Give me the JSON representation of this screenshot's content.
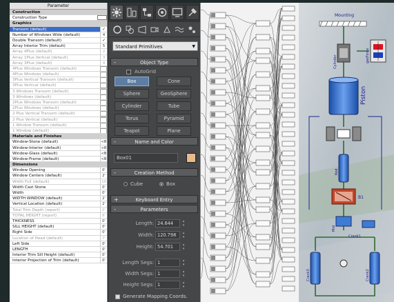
{
  "parameters_panel": {
    "header": "Parameter",
    "rows": [
      {
        "label": "Construction",
        "type": "section"
      },
      {
        "label": "Construction Type",
        "type": "field"
      },
      {
        "label": "Graphics",
        "type": "section"
      },
      {
        "label": "Transom (default)",
        "type": "check",
        "checked": true,
        "selected": true
      },
      {
        "label": "Number of Windows Wide (default)",
        "value": "4"
      },
      {
        "label": "Double Transom (default)",
        "type": "check",
        "checked": true
      },
      {
        "label": "Array Interior Trim (default)",
        "value": "5"
      },
      {
        "label": "Array 4Plus (default)",
        "value": "2",
        "dim": true
      },
      {
        "label": "Array 1Plus Vertical (default)",
        "value": "3",
        "dim": true
      },
      {
        "label": "Array 3Plus (default)",
        "value": "4",
        "dim": true
      },
      {
        "label": "4Plus Windows Transom (default)",
        "type": "box",
        "dim": true
      },
      {
        "label": "4Plus Windows (default)",
        "type": "box",
        "dim": true
      },
      {
        "label": "3Plus Vertical Transom (default)",
        "type": "box",
        "dim": true
      },
      {
        "label": "3Plus Vertical (default)",
        "type": "box",
        "dim": true
      },
      {
        "label": "3 Windows Transom (default)",
        "type": "box",
        "dim": true
      },
      {
        "label": "3 Windows (default)",
        "type": "box",
        "dim": true
      },
      {
        "label": "2Plus Windows Transom (default)",
        "type": "box",
        "dim": true
      },
      {
        "label": "2Plus Windows (default)",
        "type": "box",
        "dim": true
      },
      {
        "label": "2 Plus Vertical Transom (default)",
        "type": "box",
        "dim": true
      },
      {
        "label": "2 Plus Vertical (default)",
        "type": "box",
        "dim": true
      },
      {
        "label": "1 Window Transom (default)",
        "type": "box",
        "dim": true
      },
      {
        "label": "1 Window (default)",
        "type": "box",
        "dim": true
      },
      {
        "label": "Materials and Finishes",
        "type": "section"
      },
      {
        "label": "Window-Stone (default)",
        "value": "<B"
      },
      {
        "label": "Window-Interior (default)",
        "value": "<B"
      },
      {
        "label": "Window-Glass (default)",
        "value": "<B"
      },
      {
        "label": "Window-Frame (default)",
        "value": "<B"
      },
      {
        "label": "Dimensions",
        "type": "section"
      },
      {
        "label": "Window Opening",
        "value": "0'"
      },
      {
        "label": "Window Centers (default)",
        "value": "2'"
      },
      {
        "label": "Width Full (default)",
        "value": "10",
        "dim": true
      },
      {
        "label": "Width Cast Stone",
        "value": "0'"
      },
      {
        "label": "Width",
        "value": "0'"
      },
      {
        "label": "WIDTH WINDOW (default)",
        "value": "2'"
      },
      {
        "label": "Vertical Location (default)",
        "value": "2'"
      },
      {
        "label": "Total Trim Depth (report)",
        "value": "0'",
        "dim": true
      },
      {
        "label": "TOTAL HEIGHT (report)",
        "value": "8'",
        "dim": true
      },
      {
        "label": "THICKNESS",
        "value": "0'"
      },
      {
        "label": "SILL HEIGHT (default)",
        "value": "0'"
      },
      {
        "label": "Right Side",
        "value": "0'"
      },
      {
        "label": "Location of Head (default)",
        "value": "7'",
        "dim": true
      },
      {
        "label": "Left Side",
        "value": "0'"
      },
      {
        "label": "LENGTH",
        "value": "0'"
      },
      {
        "label": "Interior Trim Sill Height (default)",
        "value": "0'"
      },
      {
        "label": "Interior Projection of Trim (default)",
        "value": "0'"
      }
    ]
  },
  "command_panel": {
    "dropdown": "Standard Primitives",
    "object_type": {
      "title": "Object Type",
      "autogrid": "AutoGrid",
      "buttons": [
        "Box",
        "Cone",
        "Sphere",
        "GeoSphere",
        "Cylinder",
        "Tube",
        "Torus",
        "Pyramid",
        "Teapot",
        "Plane"
      ]
    },
    "name_color": {
      "title": "Name and Color",
      "name_value": "Box01",
      "color": "#e8bb8e"
    },
    "creation_method": {
      "title": "Creation Method",
      "cube": "Cube",
      "box": "Box"
    },
    "keyboard_entry": "Keyboard Entry",
    "parameters": {
      "title": "Parameters",
      "length_label": "Length:",
      "length": "24.644",
      "width_label": "Width:",
      "width": "120.798",
      "height_label": "Height:",
      "height": "54.701",
      "lsegs_label": "Length Segs:",
      "lsegs": "1",
      "wsegs_label": "Width Segs:",
      "wsegs": "1",
      "hsegs_label": "Height Segs:",
      "hsegs": "1",
      "genmap": "Generate Mapping Coords."
    }
  },
  "modelica_diagram": {
    "labels": [
      "Mounting",
      "Cylinder",
      "gasForce",
      "Piston",
      "Rod",
      "B1",
      "Mid",
      "Crank3",
      "Crank1",
      "Crank2"
    ]
  }
}
